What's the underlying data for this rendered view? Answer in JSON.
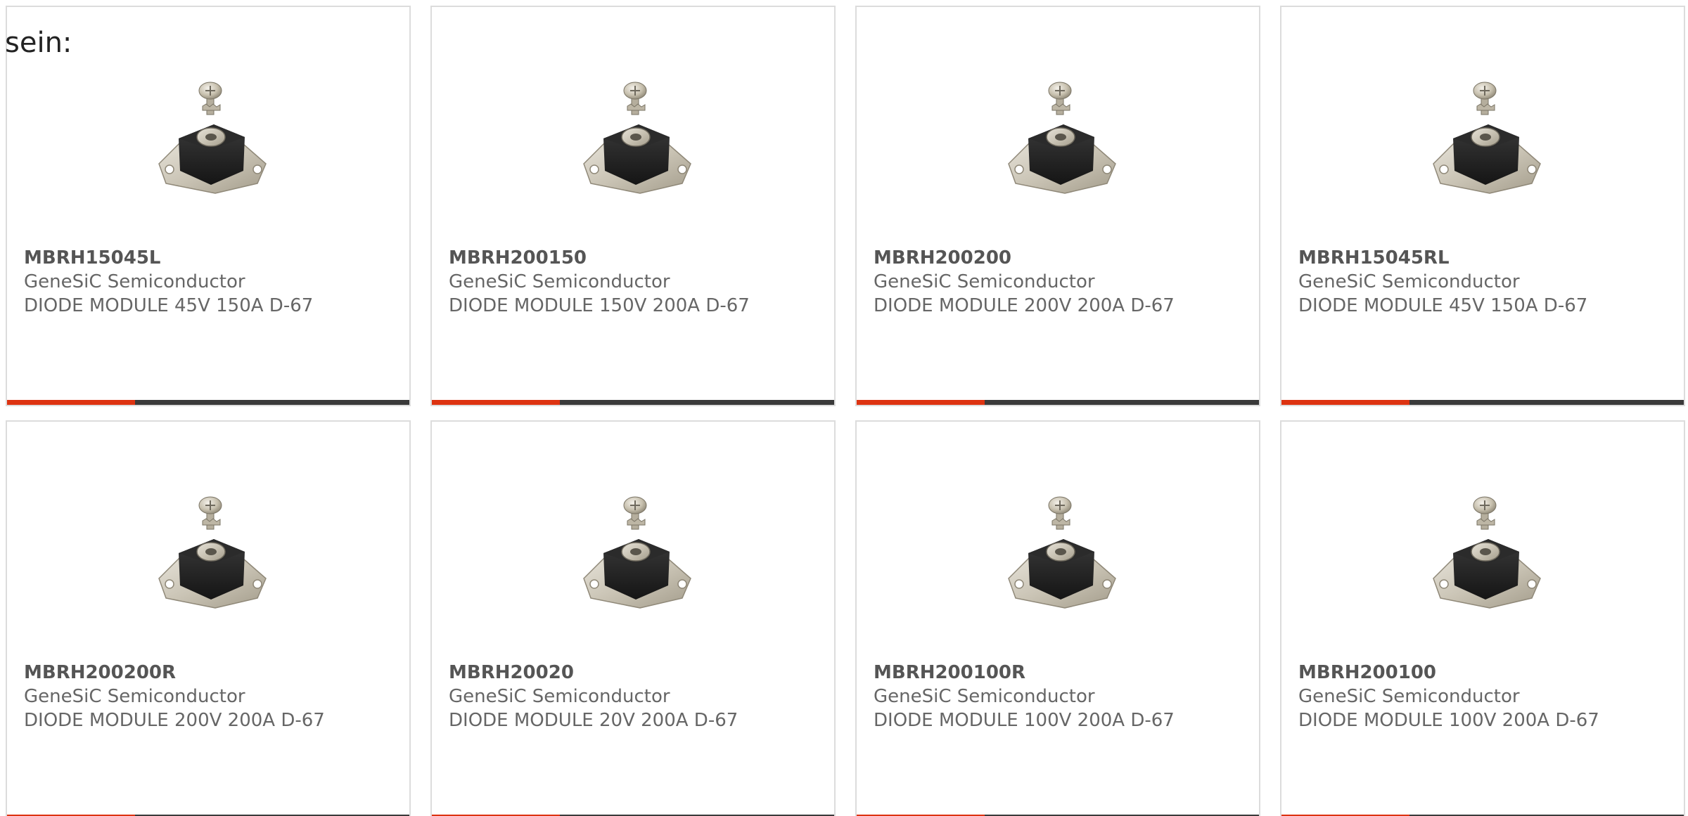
{
  "intro": {
    "text": "sein:"
  },
  "products": [
    {
      "part_number": "MBRH15045L",
      "manufacturer": "GeneSiC Semiconductor",
      "description": "DIODE MODULE 45V 150A D-67"
    },
    {
      "part_number": "MBRH200150",
      "manufacturer": "GeneSiC Semiconductor",
      "description": "DIODE MODULE 150V 200A D-67"
    },
    {
      "part_number": "MBRH200200",
      "manufacturer": "GeneSiC Semiconductor",
      "description": "DIODE MODULE 200V 200A D-67"
    },
    {
      "part_number": "MBRH15045RL",
      "manufacturer": "GeneSiC Semiconductor",
      "description": "DIODE MODULE 45V 150A D-67"
    },
    {
      "part_number": "MBRH200200R",
      "manufacturer": "GeneSiC Semiconductor",
      "description": "DIODE MODULE 200V 200A D-67"
    },
    {
      "part_number": "MBRH20020",
      "manufacturer": "GeneSiC Semiconductor",
      "description": "DIODE MODULE 20V 200A D-67"
    },
    {
      "part_number": "MBRH200100R",
      "manufacturer": "GeneSiC Semiconductor",
      "description": "DIODE MODULE 100V 200A D-67"
    },
    {
      "part_number": "MBRH200100",
      "manufacturer": "GeneSiC Semiconductor",
      "description": "DIODE MODULE 100V 200A D-67"
    }
  ],
  "colors": {
    "accent": "#dd3311",
    "bar": "#3a3a3a",
    "border": "#dcdcdc",
    "text": "#666666"
  }
}
